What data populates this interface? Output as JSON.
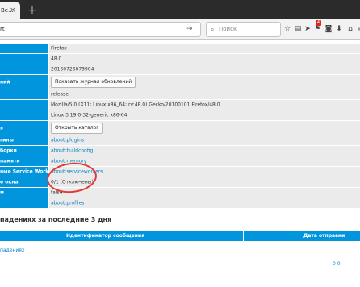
{
  "tab": {
    "title": "Ве...",
    "close": "×"
  },
  "new_tab": "+",
  "url": {
    "text": "rt",
    "arrow": "→"
  },
  "search": {
    "placeholder": "Поиск"
  },
  "toolbar": {
    "badge_count": "4"
  },
  "rows": [
    {
      "key": "",
      "value": "Firefox"
    },
    {
      "key": "",
      "value": "48.0"
    },
    {
      "key": "",
      "value": "20160726073904"
    },
    {
      "key": "ний",
      "button": "Показать журнал обновлений"
    },
    {
      "key": "",
      "value": "release"
    },
    {
      "key": "",
      "value": "Mozilla/5.0 (X11; Linux x86_64; rv:48.0) Gecko/20100101 Firefox/48.0"
    },
    {
      "key": "",
      "value": "Linux 3.19.0-32-generic x86-64"
    },
    {
      "key": "я",
      "button": "Открыть каталог"
    },
    {
      "key": "гины",
      "link": "about:plugins"
    },
    {
      "key": "борки",
      "link": "about:buildconfig"
    },
    {
      "key": "памяти",
      "link": "about:memory"
    },
    {
      "key": "ные Service Workers",
      "link": "about:serviceworkers"
    },
    {
      "key": "е окна",
      "value": "0/1 (Отключены)"
    },
    {
      "key": "м",
      "value": "false"
    },
    {
      "key": "",
      "link": "about:profiles"
    }
  ],
  "crash_section": {
    "heading": "падениях за последние 3 дня",
    "col_id": "Идентификатор сообщения",
    "col_date": "Дата отправки",
    "link": "падениях"
  },
  "status": {
    "text": "0 0"
  }
}
